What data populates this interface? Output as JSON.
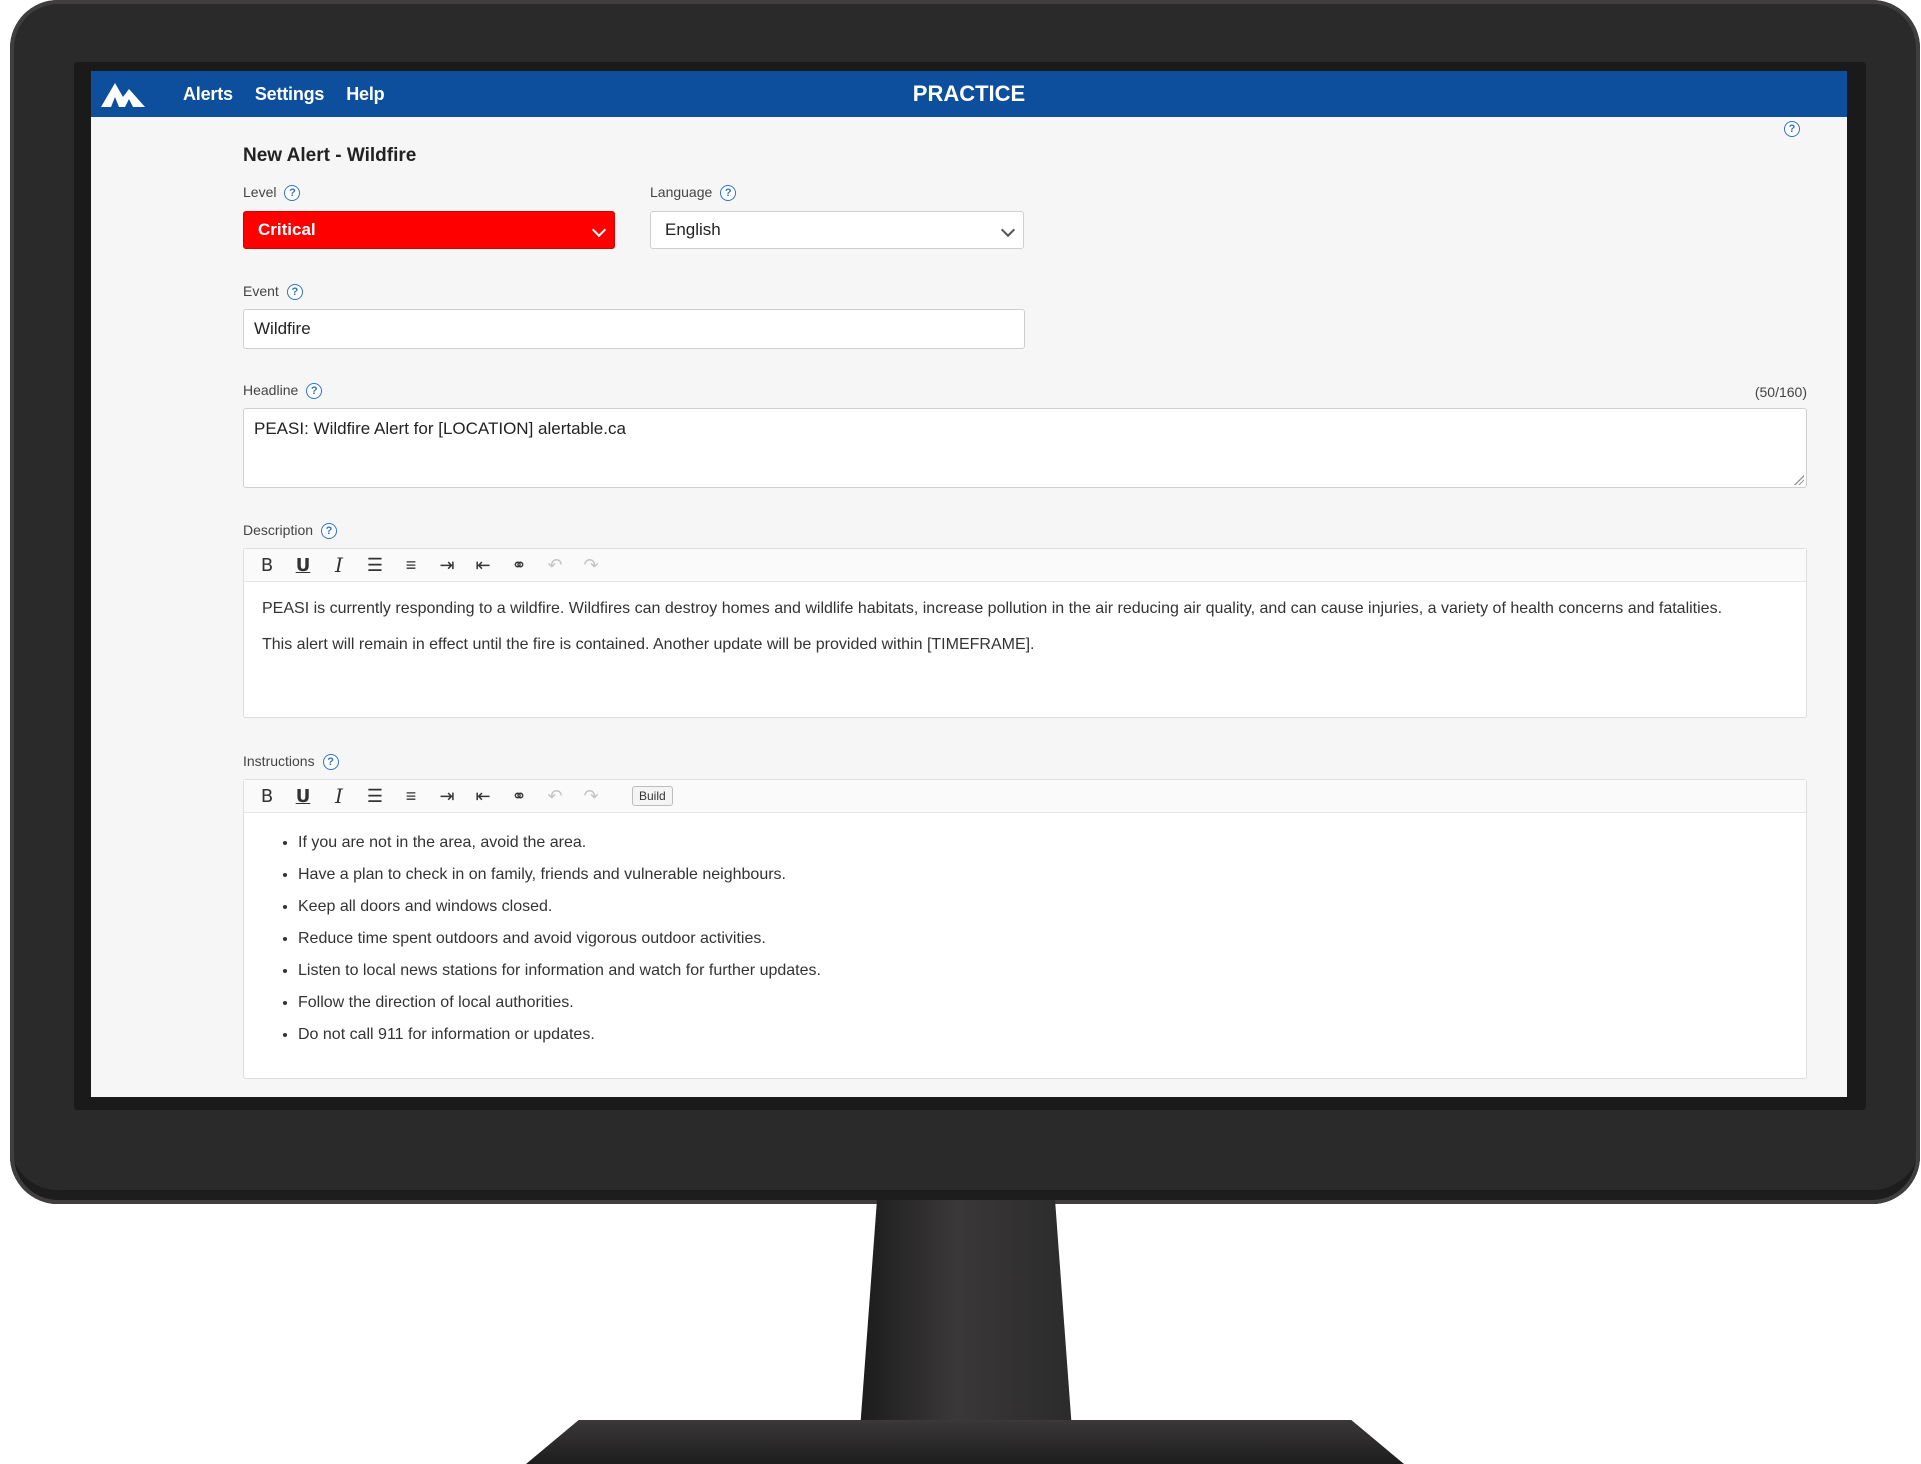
{
  "nav": {
    "items": [
      "Alerts",
      "Settings",
      "Help"
    ],
    "mode": "PRACTICE",
    "bar_color": "#0d4f9c"
  },
  "form": {
    "title": "New Alert - Wildfire",
    "level": {
      "label": "Level",
      "value": "Critical",
      "color": "#ff0000"
    },
    "language": {
      "label": "Language",
      "value": "English"
    },
    "event": {
      "label": "Event",
      "value": "Wildfire"
    },
    "headline": {
      "label": "Headline",
      "counter": "(50/160)",
      "value": "PEASI: Wildfire Alert for [LOCATION]  alertable.ca"
    },
    "description": {
      "label": "Description",
      "paragraphs": [
        "PEASI is currently responding to a wildfire. Wildfires can destroy homes and wildlife habitats, increase pollution in the air reducing air quality, and can cause injuries, a variety of health concerns and fatalities.",
        "This alert will remain in effect until the fire is contained. Another update will be provided within [TIMEFRAME]."
      ]
    },
    "instructions": {
      "label": "Instructions",
      "build_label": "Build",
      "items": [
        "If you are not in the area, avoid the area.",
        "Have a plan to check in on family, friends and vulnerable neighbours.",
        "Keep all doors and windows closed.",
        "Reduce time spent outdoors and avoid vigorous outdoor activities.",
        "Listen to local news stations for information and watch for further updates.",
        "Follow the direction of local authorities.",
        "Do not call 911 for information or updates."
      ]
    },
    "toolbar": {
      "bold": "B",
      "underline": "U",
      "italic": "I",
      "icons": [
        "bullet-list-icon",
        "numbered-list-icon",
        "indent-icon",
        "outdent-icon",
        "unlink-icon",
        "undo-icon",
        "redo-icon"
      ]
    },
    "help_glyph": "?"
  }
}
